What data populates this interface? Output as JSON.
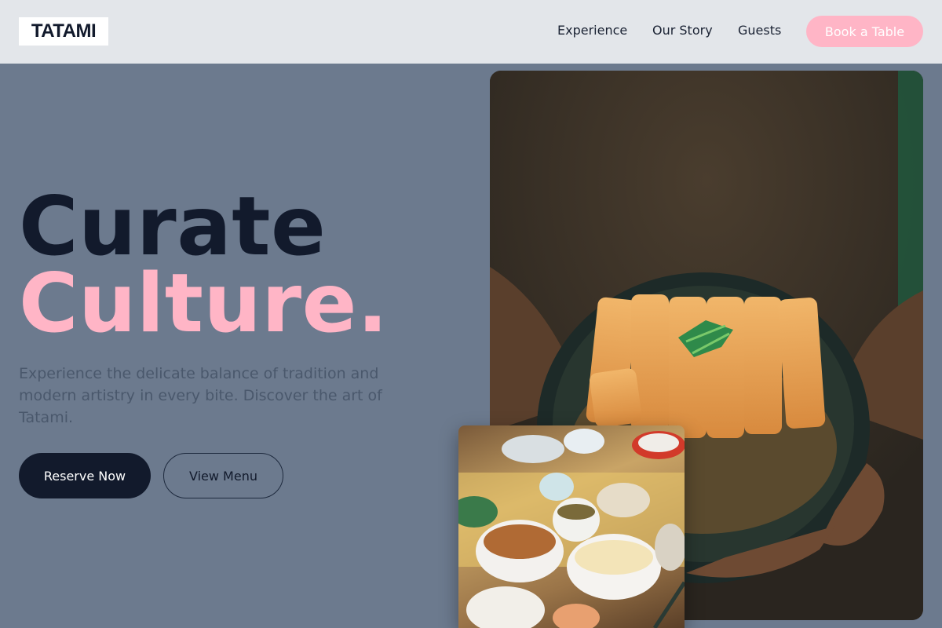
{
  "nav": {
    "logo": "TATAMI",
    "links": [
      "Experience",
      "Our Story",
      "Guests"
    ],
    "cta": "Book a Table"
  },
  "hero": {
    "title_line1": "Curate",
    "title_line2": "Culture.",
    "subtitle": "Experience the delicate balance of tradition and modern artistry in every bite. Discover the art of Tatami.",
    "primary_button": "Reserve Now",
    "secondary_button": "View Menu"
  },
  "images": {
    "main": "katsu-bowl-photo",
    "secondary": "japanese-table-spread-photo"
  },
  "colors": {
    "background": "#6c7a8e",
    "nav_background": "#e3e6ea",
    "accent_pink": "#ffb5c6",
    "dark": "#121a2c",
    "muted_text": "#4a586c"
  }
}
